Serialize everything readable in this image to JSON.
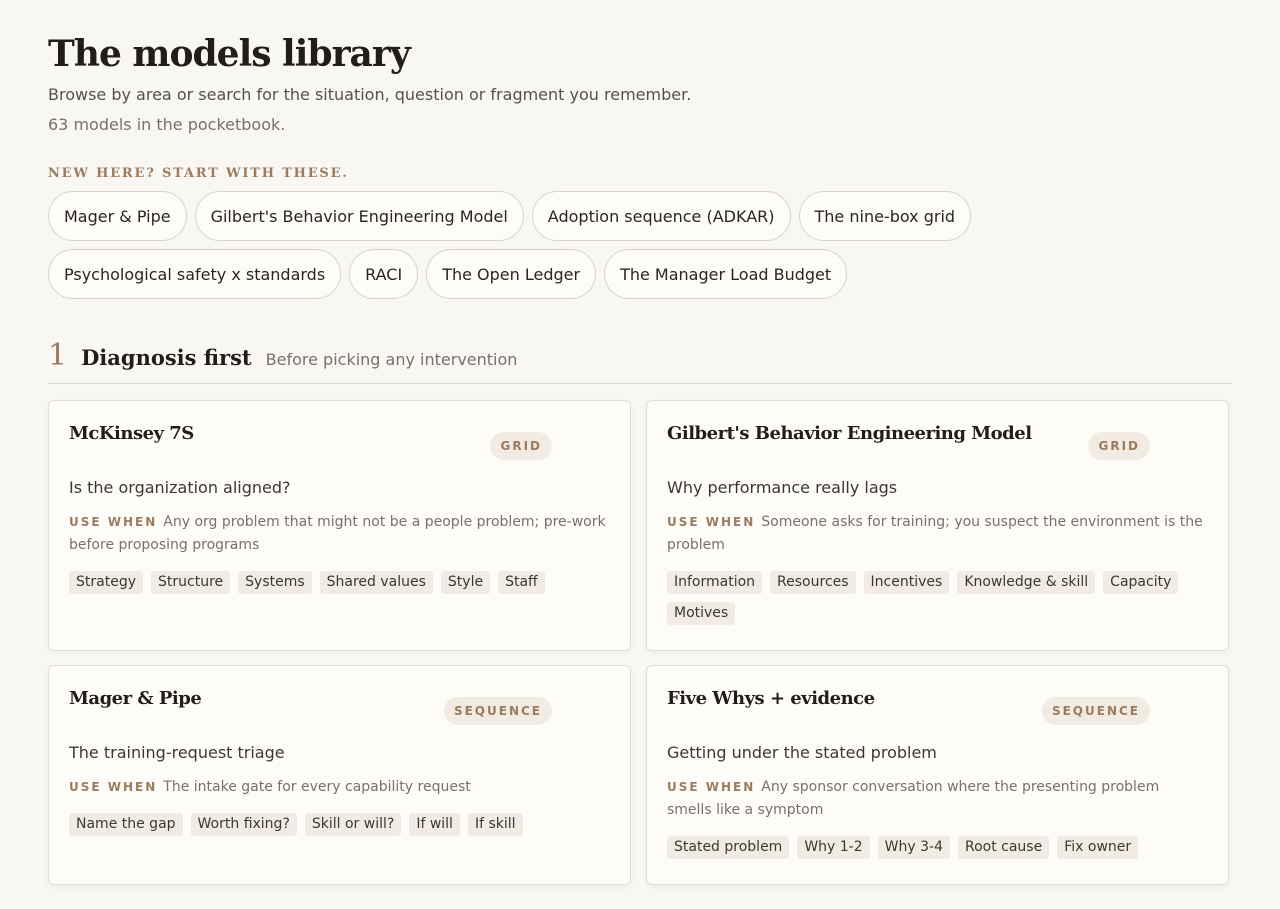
{
  "header": {
    "title": "The models library",
    "subtitle": "Browse by area or search for the situation, question or fragment you remember.",
    "count": "63 models in the pocketbook."
  },
  "starter": {
    "heading": "New here? Start with these.",
    "chips": [
      {
        "label": "Mager & Pipe"
      },
      {
        "label": "Gilbert's Behavior Engineering Model"
      },
      {
        "label": "Adoption sequence (ADKAR)"
      },
      {
        "label": "The nine-box grid"
      },
      {
        "label": "Psychological safety x standards"
      },
      {
        "label": "RACI"
      },
      {
        "label": "The Open Ledger"
      },
      {
        "label": "The Manager Load Budget"
      }
    ]
  },
  "section": {
    "number": "1",
    "title": "Diagnosis first",
    "subtitle": "Before picking any intervention"
  },
  "use_when_label": "USE WHEN",
  "cards": [
    {
      "title": "McKinsey 7S",
      "badge": "GRID",
      "question": "Is the organization aligned?",
      "use_when": "Any org problem that might not be a people problem; pre-work before proposing programs",
      "tags": [
        "Strategy",
        "Structure",
        "Systems",
        "Shared values",
        "Style",
        "Staff"
      ]
    },
    {
      "title": "Gilbert's Behavior Engineering Model",
      "badge": "GRID",
      "question": "Why performance really lags",
      "use_when": "Someone asks for training; you suspect the environment is the problem",
      "tags": [
        "Information",
        "Resources",
        "Incentives",
        "Knowledge & skill",
        "Capacity",
        "Motives"
      ]
    },
    {
      "title": "Mager & Pipe",
      "badge": "SEQUENCE",
      "question": "The training-request triage",
      "use_when": "The intake gate for every capability request",
      "tags": [
        "Name the gap",
        "Worth fixing?",
        "Skill or will?",
        "If will",
        "If skill"
      ]
    },
    {
      "title": "Five Whys + evidence",
      "badge": "SEQUENCE",
      "question": "Getting under the stated problem",
      "use_when": "Any sponsor conversation where the presenting problem smells like a symptom",
      "tags": [
        "Stated problem",
        "Why 1-2",
        "Why 3-4",
        "Root cause",
        "Fix owner"
      ]
    }
  ]
}
